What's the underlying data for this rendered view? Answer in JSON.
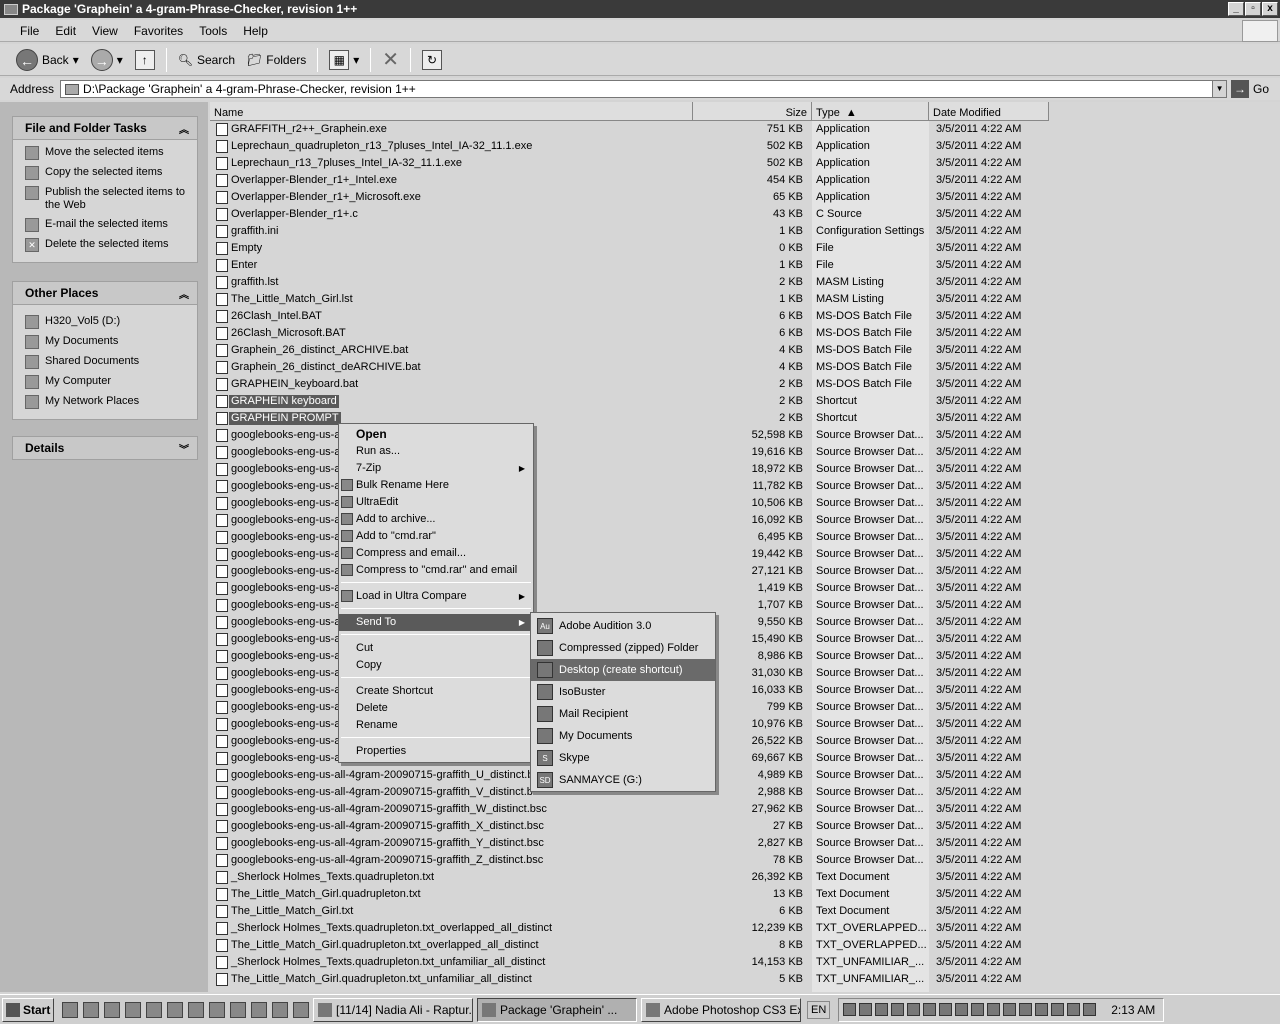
{
  "window": {
    "title": "Package 'Graphein' a 4-gram-Phrase-Checker, revision 1++",
    "minimize": "_",
    "maximize": "▫",
    "close": "x"
  },
  "menu": [
    "File",
    "Edit",
    "View",
    "Favorites",
    "Tools",
    "Help"
  ],
  "toolbar": {
    "back": "Back",
    "search": "Search",
    "folders": "Folders"
  },
  "address": {
    "label": "Address",
    "path": "D:\\Package 'Graphein' a 4-gram-Phrase-Checker, revision 1++",
    "go": "Go"
  },
  "tasks_panel": {
    "title": "File and Folder Tasks",
    "items": [
      "Move the selected items",
      "Copy the selected items",
      "Publish the selected items to the Web",
      "E-mail the selected items",
      "Delete the selected items"
    ]
  },
  "places_panel": {
    "title": "Other Places",
    "items": [
      "H320_Vol5 (D:)",
      "My Documents",
      "Shared Documents",
      "My Computer",
      "My Network Places"
    ]
  },
  "details_panel": {
    "title": "Details"
  },
  "columns": {
    "name": "Name",
    "size": "Size",
    "type": "Type",
    "date": "Date Modified"
  },
  "files": [
    {
      "name": "GRAFFITH_r2++_Graphein.exe",
      "size": "751 KB",
      "type": "Application",
      "date": "3/5/2011 4:22 AM"
    },
    {
      "name": "Leprechaun_quadrupleton_r13_7pluses_Intel_IA-32_11.1.exe",
      "size": "502 KB",
      "type": "Application",
      "date": "3/5/2011 4:22 AM"
    },
    {
      "name": "Leprechaun_r13_7pluses_Intel_IA-32_11.1.exe",
      "size": "502 KB",
      "type": "Application",
      "date": "3/5/2011 4:22 AM"
    },
    {
      "name": "Overlapper-Blender_r1+_Intel.exe",
      "size": "454 KB",
      "type": "Application",
      "date": "3/5/2011 4:22 AM"
    },
    {
      "name": "Overlapper-Blender_r1+_Microsoft.exe",
      "size": "65 KB",
      "type": "Application",
      "date": "3/5/2011 4:22 AM"
    },
    {
      "name": "Overlapper-Blender_r1+.c",
      "size": "43 KB",
      "type": "C Source",
      "date": "3/5/2011 4:22 AM"
    },
    {
      "name": "graffith.ini",
      "size": "1 KB",
      "type": "Configuration Settings",
      "date": "3/5/2011 4:22 AM"
    },
    {
      "name": "Empty",
      "size": "0 KB",
      "type": "File",
      "date": "3/5/2011 4:22 AM"
    },
    {
      "name": "Enter",
      "size": "1 KB",
      "type": "File",
      "date": "3/5/2011 4:22 AM"
    },
    {
      "name": "graffith.lst",
      "size": "2 KB",
      "type": "MASM Listing",
      "date": "3/5/2011 4:22 AM"
    },
    {
      "name": "The_Little_Match_Girl.lst",
      "size": "1 KB",
      "type": "MASM Listing",
      "date": "3/5/2011 4:22 AM"
    },
    {
      "name": "26Clash_Intel.BAT",
      "size": "6 KB",
      "type": "MS-DOS Batch File",
      "date": "3/5/2011 4:22 AM"
    },
    {
      "name": "26Clash_Microsoft.BAT",
      "size": "6 KB",
      "type": "MS-DOS Batch File",
      "date": "3/5/2011 4:22 AM"
    },
    {
      "name": "Graphein_26_distinct_ARCHIVE.bat",
      "size": "4 KB",
      "type": "MS-DOS Batch File",
      "date": "3/5/2011 4:22 AM"
    },
    {
      "name": "Graphein_26_distinct_deARCHIVE.bat",
      "size": "4 KB",
      "type": "MS-DOS Batch File",
      "date": "3/5/2011 4:22 AM"
    },
    {
      "name": "GRAPHEIN_keyboard.bat",
      "size": "2 KB",
      "type": "MS-DOS Batch File",
      "date": "3/5/2011 4:22 AM"
    },
    {
      "name": "GRAPHEIN keyboard",
      "size": "2 KB",
      "type": "Shortcut",
      "date": "3/5/2011 4:22 AM",
      "selected": true
    },
    {
      "name": "GRAPHEIN PROMPT",
      "size": "2 KB",
      "type": "Shortcut",
      "date": "3/5/2011 4:22 AM",
      "selected": true
    },
    {
      "name": "googlebooks-eng-us-a",
      "size": "52,598 KB",
      "type": "Source Browser Dat...",
      "date": "3/5/2011 4:22 AM"
    },
    {
      "name": "googlebooks-eng-us-a",
      "size": "19,616 KB",
      "type": "Source Browser Dat...",
      "date": "3/5/2011 4:22 AM"
    },
    {
      "name": "googlebooks-eng-us-a",
      "size": "18,972 KB",
      "type": "Source Browser Dat...",
      "date": "3/5/2011 4:22 AM"
    },
    {
      "name": "googlebooks-eng-us-a",
      "size": "11,782 KB",
      "type": "Source Browser Dat...",
      "date": "3/5/2011 4:22 AM"
    },
    {
      "name": "googlebooks-eng-us-a",
      "size": "10,506 KB",
      "type": "Source Browser Dat...",
      "date": "3/5/2011 4:22 AM"
    },
    {
      "name": "googlebooks-eng-us-a",
      "size": "16,092 KB",
      "type": "Source Browser Dat...",
      "date": "3/5/2011 4:22 AM"
    },
    {
      "name": "googlebooks-eng-us-a",
      "size": "6,495 KB",
      "type": "Source Browser Dat...",
      "date": "3/5/2011 4:22 AM"
    },
    {
      "name": "googlebooks-eng-us-a",
      "size": "19,442 KB",
      "type": "Source Browser Dat...",
      "date": "3/5/2011 4:22 AM"
    },
    {
      "name": "googlebooks-eng-us-a",
      "size": "27,121 KB",
      "type": "Source Browser Dat...",
      "date": "3/5/2011 4:22 AM"
    },
    {
      "name": "googlebooks-eng-us-a",
      "size": "1,419 KB",
      "type": "Source Browser Dat...",
      "date": "3/5/2011 4:22 AM"
    },
    {
      "name": "googlebooks-eng-us-a",
      "size": "1,707 KB",
      "type": "Source Browser Dat...",
      "date": "3/5/2011 4:22 AM"
    },
    {
      "name": "googlebooks-eng-us-a",
      "size": "9,550 KB",
      "type": "Source Browser Dat...",
      "date": "3/5/2011 4:22 AM"
    },
    {
      "name": "googlebooks-eng-us-a",
      "size": "15,490 KB",
      "type": "Source Browser Dat...",
      "date": "3/5/2011 4:22 AM"
    },
    {
      "name": "googlebooks-eng-us-a",
      "size": "8,986 KB",
      "type": "Source Browser Dat...",
      "date": "3/5/2011 4:22 AM"
    },
    {
      "name": "googlebooks-eng-us-a",
      "size": "31,030 KB",
      "type": "Source Browser Dat...",
      "date": "3/5/2011 4:22 AM"
    },
    {
      "name": "googlebooks-eng-us-a",
      "size": "16,033 KB",
      "type": "Source Browser Dat...",
      "date": "3/5/2011 4:22 AM"
    },
    {
      "name": "googlebooks-eng-us-a",
      "size": "799 KB",
      "type": "Source Browser Dat...",
      "date": "3/5/2011 4:22 AM"
    },
    {
      "name": "googlebooks-eng-us-a",
      "size": "10,976 KB",
      "type": "Source Browser Dat...",
      "date": "3/5/2011 4:22 AM"
    },
    {
      "name": "googlebooks-eng-us-a",
      "size": "26,522 KB",
      "type": "Source Browser Dat...",
      "date": "3/5/2011 4:22 AM"
    },
    {
      "name": "googlebooks-eng-us-a",
      "size": "69,667 KB",
      "type": "Source Browser Dat...",
      "date": "3/5/2011 4:22 AM"
    },
    {
      "name": "googlebooks-eng-us-all-4gram-20090715-graffith_U_distinct.bsc",
      "size": "4,989 KB",
      "type": "Source Browser Dat...",
      "date": "3/5/2011 4:22 AM"
    },
    {
      "name": "googlebooks-eng-us-all-4gram-20090715-graffith_V_distinct.bsc",
      "size": "2,988 KB",
      "type": "Source Browser Dat...",
      "date": "3/5/2011 4:22 AM"
    },
    {
      "name": "googlebooks-eng-us-all-4gram-20090715-graffith_W_distinct.bsc",
      "size": "27,962 KB",
      "type": "Source Browser Dat...",
      "date": "3/5/2011 4:22 AM"
    },
    {
      "name": "googlebooks-eng-us-all-4gram-20090715-graffith_X_distinct.bsc",
      "size": "27 KB",
      "type": "Source Browser Dat...",
      "date": "3/5/2011 4:22 AM"
    },
    {
      "name": "googlebooks-eng-us-all-4gram-20090715-graffith_Y_distinct.bsc",
      "size": "2,827 KB",
      "type": "Source Browser Dat...",
      "date": "3/5/2011 4:22 AM"
    },
    {
      "name": "googlebooks-eng-us-all-4gram-20090715-graffith_Z_distinct.bsc",
      "size": "78 KB",
      "type": "Source Browser Dat...",
      "date": "3/5/2011 4:22 AM"
    },
    {
      "name": "_Sherlock Holmes_Texts.quadrupleton.txt",
      "size": "26,392 KB",
      "type": "Text Document",
      "date": "3/5/2011 4:22 AM"
    },
    {
      "name": "The_Little_Match_Girl.quadrupleton.txt",
      "size": "13 KB",
      "type": "Text Document",
      "date": "3/5/2011 4:22 AM"
    },
    {
      "name": "The_Little_Match_Girl.txt",
      "size": "6 KB",
      "type": "Text Document",
      "date": "3/5/2011 4:22 AM"
    },
    {
      "name": "_Sherlock Holmes_Texts.quadrupleton.txt_overlapped_all_distinct",
      "size": "12,239 KB",
      "type": "TXT_OVERLAPPED...",
      "date": "3/5/2011 4:22 AM"
    },
    {
      "name": "The_Little_Match_Girl.quadrupleton.txt_overlapped_all_distinct",
      "size": "8 KB",
      "type": "TXT_OVERLAPPED...",
      "date": "3/5/2011 4:22 AM"
    },
    {
      "name": "_Sherlock Holmes_Texts.quadrupleton.txt_unfamiliar_all_distinct",
      "size": "14,153 KB",
      "type": "TXT_UNFAMILIAR_...",
      "date": "3/5/2011 4:22 AM"
    },
    {
      "name": "The_Little_Match_Girl.quadrupleton.txt_unfamiliar_all_distinct",
      "size": "5 KB",
      "type": "TXT_UNFAMILIAR_...",
      "date": "3/5/2011 4:22 AM"
    }
  ],
  "context_menu": {
    "open": "Open",
    "run_as": "Run as...",
    "zip": "7-Zip",
    "bulk_rename": "Bulk Rename Here",
    "ultraedit": "UltraEdit",
    "add_archive": "Add to archive...",
    "add_rar": "Add to \"cmd.rar\"",
    "compress_email": "Compress and email...",
    "compress_rar_email": "Compress to \"cmd.rar\" and email",
    "ultra_compare": "Load in Ultra Compare",
    "send_to": "Send To",
    "cut": "Cut",
    "copy": "Copy",
    "create_shortcut": "Create Shortcut",
    "delete": "Delete",
    "rename": "Rename",
    "properties": "Properties"
  },
  "send_to_menu": [
    {
      "label": "Adobe Audition 3.0",
      "icon": "Au"
    },
    {
      "label": "Compressed (zipped) Folder",
      "icon": ""
    },
    {
      "label": "Desktop (create shortcut)",
      "icon": "",
      "highlighted": true
    },
    {
      "label": "IsoBuster",
      "icon": ""
    },
    {
      "label": "Mail Recipient",
      "icon": ""
    },
    {
      "label": "My Documents",
      "icon": ""
    },
    {
      "label": "Skype",
      "icon": "S"
    },
    {
      "label": "SANMAYCE (G:)",
      "icon": "SD"
    }
  ],
  "taskbar": {
    "start": "Start",
    "tasks": [
      "[11/14] Nadia Ali - Raptur...",
      "Package 'Graphein' ...",
      "Adobe Photoshop CS3 Ex..."
    ],
    "lang": "EN",
    "clock": "2:13 AM"
  }
}
